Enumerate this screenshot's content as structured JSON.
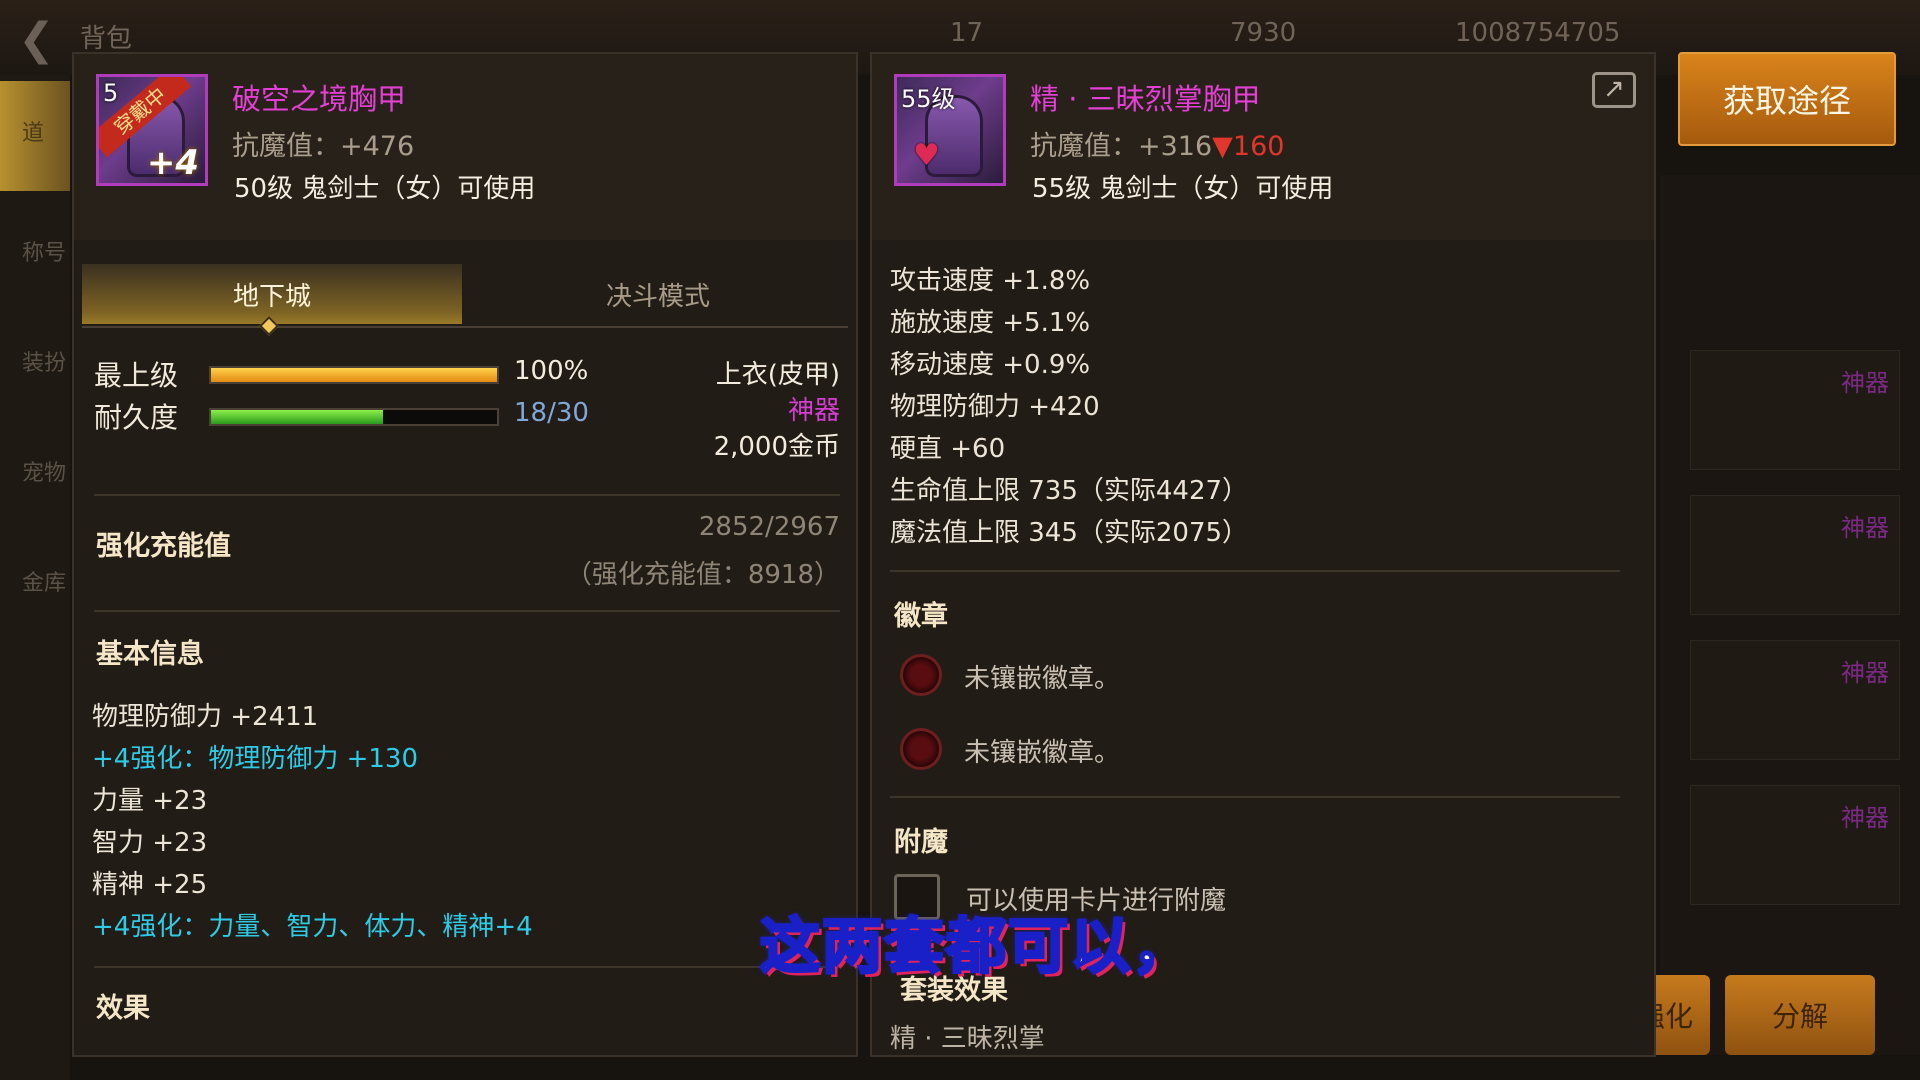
{
  "topbar": {
    "title": "背包",
    "stamina": "17",
    "gems": "7930",
    "gold": "1008754705"
  },
  "left_nav": [
    "道",
    "称号",
    "装扮",
    "宠物",
    "金库"
  ],
  "bg_right_tags": [
    "神器",
    "神器",
    "神器",
    "神器",
    "神器"
  ],
  "bg_buttons": {
    "enhance": "强化",
    "decompose": "分解"
  },
  "left_panel": {
    "icon": {
      "level": "5",
      "ribbon": "穿戴中",
      "plus": "+4"
    },
    "name": "破空之境胸甲",
    "resist": "抗魔值：+476",
    "usable": "50级 鬼剑士（女）可使用",
    "tabs": {
      "dungeon": "地下城",
      "duel": "决斗模式"
    },
    "grade": {
      "label": "最上级",
      "value": "100%",
      "fraction": 1.0
    },
    "durability": {
      "label": "耐久度",
      "value": "18/30",
      "fraction": 0.6
    },
    "type": "上衣(皮甲)",
    "rarity": "神器",
    "price": "2,000金币",
    "charge": {
      "title": "强化充能值",
      "value": "2852/2967",
      "sub": "（强化充能值：8918）"
    },
    "basic_info_title": "基本信息",
    "attributes": [
      {
        "text": "物理防御力 +2411",
        "color": "white"
      },
      {
        "text": "+4强化：物理防御力 +130",
        "color": "cyan"
      },
      {
        "text": "力量 +23",
        "color": "white"
      },
      {
        "text": "智力 +23",
        "color": "white"
      },
      {
        "text": "精神 +25",
        "color": "white"
      },
      {
        "text": "+4强化：力量、智力、体力、精神+4",
        "color": "cyan"
      }
    ],
    "effect_title": "效果"
  },
  "right_panel": {
    "icon": {
      "level": "55级"
    },
    "name": "精 · 三昧烈掌胸甲",
    "resist": "抗魔值：+316",
    "resist_diff": "▼160",
    "usable": "55级 鬼剑士（女）可使用",
    "attributes": [
      "攻击速度 +1.8%",
      "施放速度 +5.1%",
      "移动速度 +0.9%",
      "物理防御力 +420",
      "硬直 +60",
      "生命值上限 735（实际4427）",
      "魔法值上限 345（实际2075）"
    ],
    "badge_title": "徽章",
    "badges": [
      "未镶嵌徽章。",
      "未镶嵌徽章。"
    ],
    "enchant_title": "附魔",
    "enchant_text": "可以使用卡片进行附魔",
    "set_title": "套装效果",
    "set_name": "精 · 三昧烈掌"
  },
  "get_route_button": "获取途径",
  "subtitle": "这两套都可以，"
}
